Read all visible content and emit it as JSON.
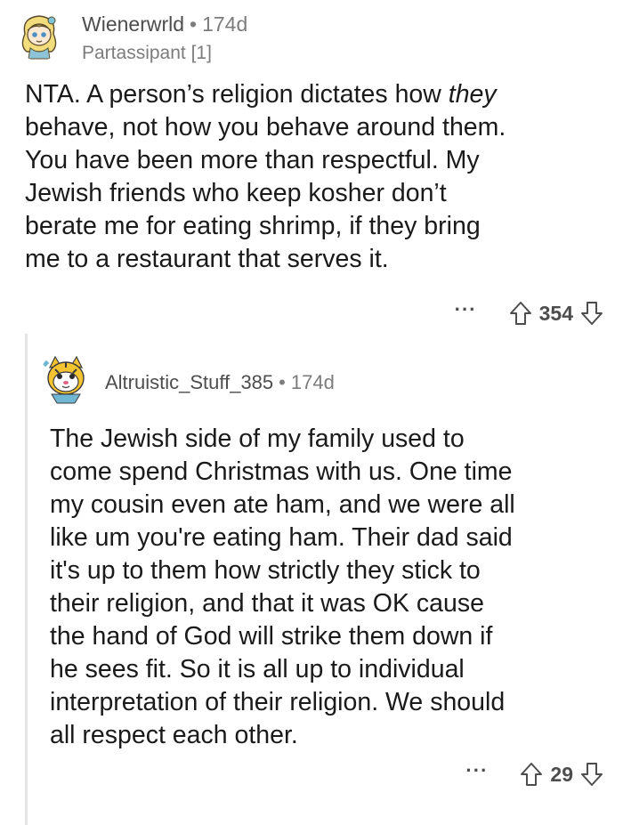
{
  "comment1": {
    "username": "Wienerwrld",
    "separator": "•",
    "age": "174d",
    "flair": "Partassipant [1]",
    "body_lines": [
      {
        "pre": "NTA. A person’s religion dictates how ",
        "em": "they",
        "post": ""
      },
      {
        "pre": "behave, not how you behave around them.",
        "em": "",
        "post": ""
      },
      {
        "pre": "You have been more than respectful. My",
        "em": "",
        "post": ""
      },
      {
        "pre": "Jewish friends who keep kosher don’t",
        "em": "",
        "post": ""
      },
      {
        "pre": "berate me for eating shrimp, if they bring",
        "em": "",
        "post": ""
      },
      {
        "pre": "me to a restaurant that serves it.",
        "em": "",
        "post": ""
      }
    ],
    "more": "···",
    "score": "354",
    "upvote_icon": "arrow-up-icon",
    "downvote_icon": "arrow-down-icon"
  },
  "comment2": {
    "username": "Altruistic_Stuff_385",
    "separator": "•",
    "age": "174d",
    "body_lines": [
      "The Jewish side of my family used to",
      "come spend Christmas with us. One time",
      "my cousin even ate ham, and we were all",
      "like um you're eating ham. Their dad said",
      "it's up to them how strictly they stick to",
      "their religion, and that it was OK cause",
      "the hand of God will strike them down if",
      "he sees fit. So it is all up to individual",
      "interpretation of their religion. We should",
      "all respect each other."
    ],
    "more": "···",
    "score": "29",
    "upvote_icon": "arrow-up-icon",
    "downvote_icon": "arrow-down-icon"
  }
}
